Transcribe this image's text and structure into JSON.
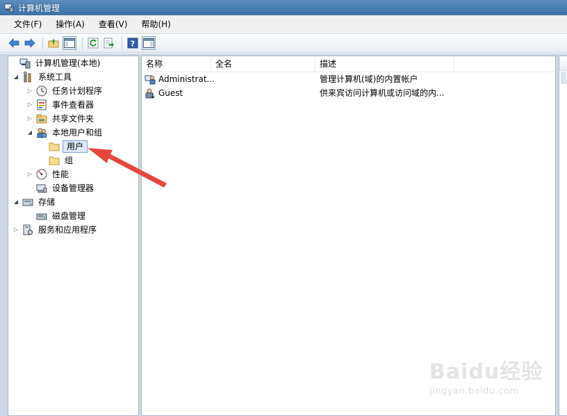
{
  "window": {
    "title": "计算机管理"
  },
  "menu": [
    {
      "label": "文件(F)"
    },
    {
      "label": "操作(A)"
    },
    {
      "label": "查看(V)"
    },
    {
      "label": "帮助(H)"
    }
  ],
  "tree": {
    "root": {
      "label": "计算机管理(本地)",
      "icon": "computer-management-icon"
    },
    "system_tools": {
      "label": "系统工具",
      "icon": "tools-icon"
    },
    "task_scheduler": {
      "label": "任务计划程序",
      "icon": "clock-icon"
    },
    "event_viewer": {
      "label": "事件查看器",
      "icon": "event-log-icon"
    },
    "shared_folders": {
      "label": "共享文件夹",
      "icon": "shared-folder-icon"
    },
    "local_users": {
      "label": "本地用户和组",
      "icon": "users-icon"
    },
    "users": {
      "label": "用户",
      "icon": "folder-icon"
    },
    "groups": {
      "label": "组",
      "icon": "folder-icon"
    },
    "performance": {
      "label": "性能",
      "icon": "performance-icon"
    },
    "device_manager": {
      "label": "设备管理器",
      "icon": "device-manager-icon"
    },
    "storage": {
      "label": "存储",
      "icon": "storage-icon"
    },
    "disk_management": {
      "label": "磁盘管理",
      "icon": "disk-icon"
    },
    "services_apps": {
      "label": "服务和应用程序",
      "icon": "services-icon"
    }
  },
  "list": {
    "columns": [
      "名称",
      "全名",
      "描述"
    ],
    "rows": [
      {
        "name": "Administrat...",
        "fullname": "",
        "description": "管理计算机(域)的内置帐户",
        "icon": "user-icon"
      },
      {
        "name": "Guest",
        "fullname": "",
        "description": "供来宾访问计算机或访问域的内...",
        "icon": "guest-user-icon"
      }
    ]
  },
  "watermark": {
    "logo": "Baidu经验",
    "url": "jingyan.baidu.com"
  },
  "colors": {
    "annotation_arrow": "#e8453c",
    "selection": "#dbe8f7",
    "titlebar": "#4a7fb3"
  }
}
